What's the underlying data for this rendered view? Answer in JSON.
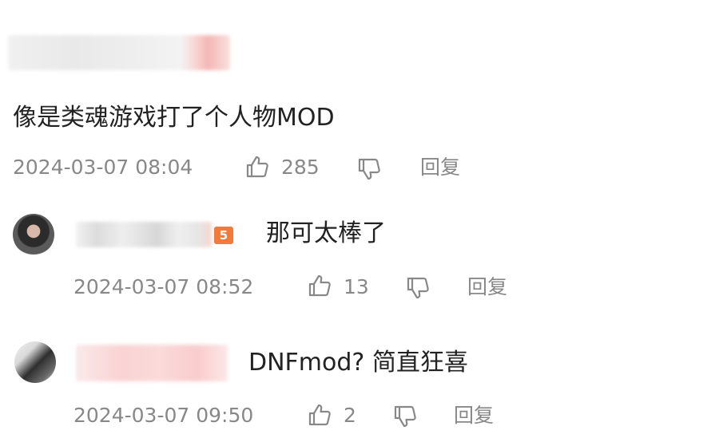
{
  "comments": [
    {
      "text": "像是类魂游戏打了个人物MOD",
      "timestamp": "2024-03-07 08:04",
      "likes": "285",
      "reply_label": "回复"
    },
    {
      "level_badge": "5",
      "text": "那可太棒了",
      "timestamp": "2024-03-07 08:52",
      "likes": "13",
      "reply_label": "回复"
    },
    {
      "text": "DNFmod? 简直狂喜",
      "timestamp": "2024-03-07 09:50",
      "likes": "2",
      "reply_label": "回复"
    }
  ],
  "colors": {
    "text": "#222222",
    "meta": "#888888",
    "level_badge": "#f27a3b"
  },
  "icons": [
    "thumbs-up-icon",
    "thumbs-down-icon"
  ]
}
